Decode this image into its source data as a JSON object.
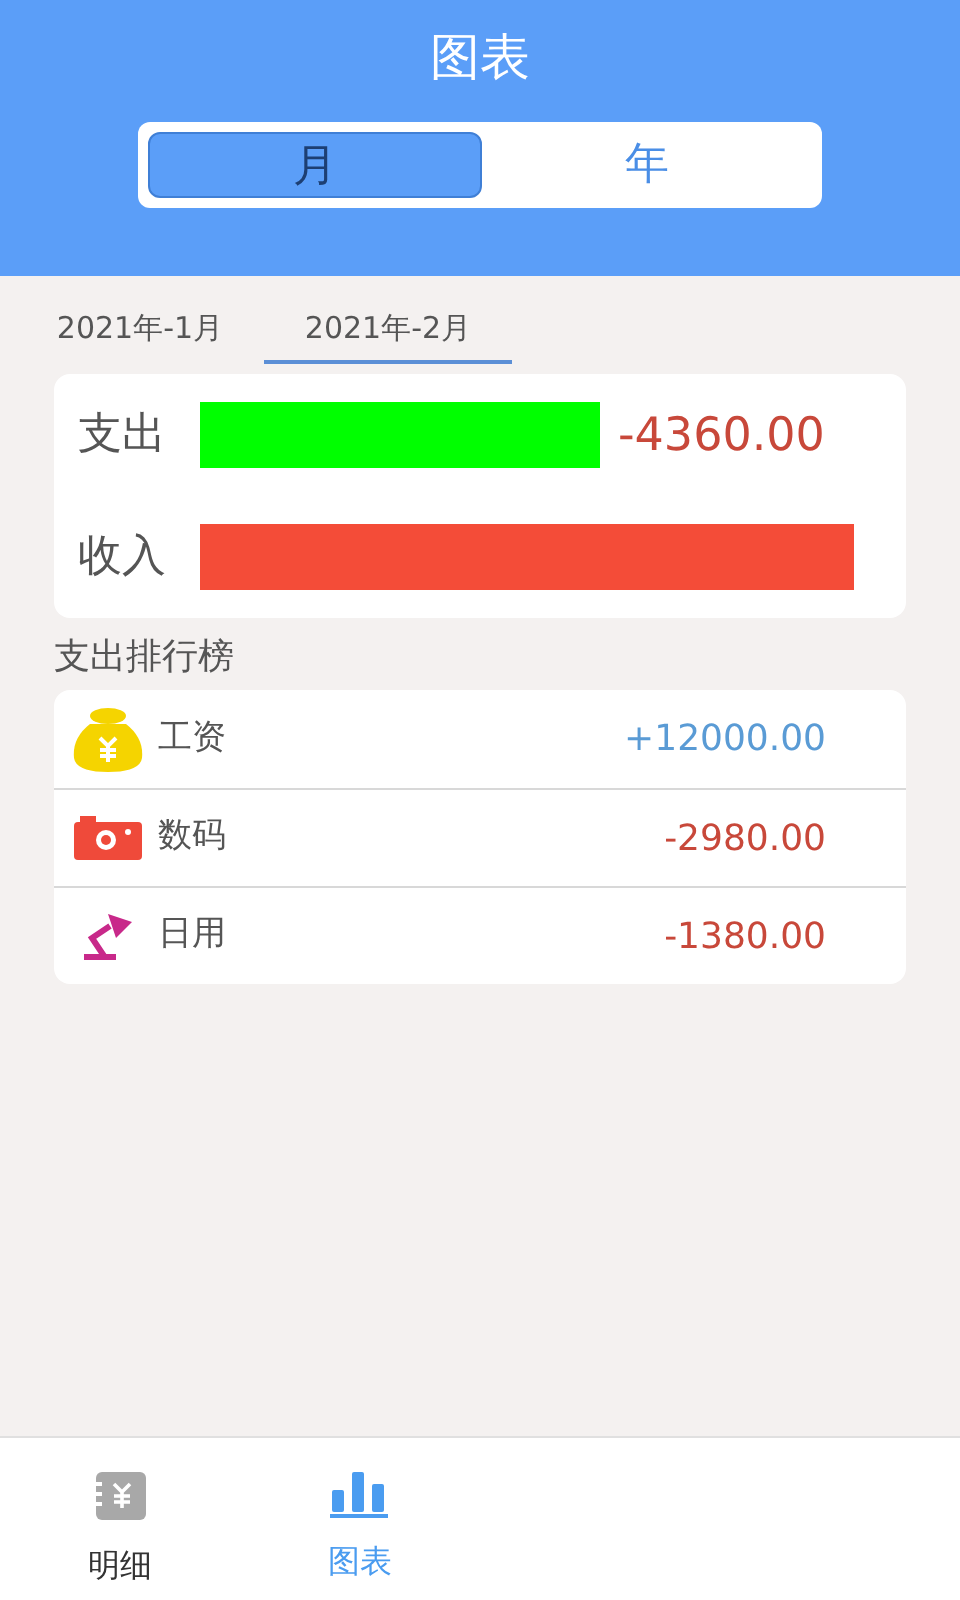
{
  "header": {
    "title": "图表"
  },
  "segments": [
    {
      "label": "月",
      "selected": true
    },
    {
      "label": "年",
      "selected": false
    }
  ],
  "month_tabs": [
    {
      "label": "2021年-1月",
      "selected": false
    },
    {
      "label": "2021年-2月",
      "selected": true
    }
  ],
  "summary": [
    {
      "label": "支出",
      "color": "#00ff00",
      "amount": "-4360.00"
    },
    {
      "label": "收入",
      "color": "#f44c38"
    }
  ],
  "ranking": {
    "title": "支出排行榜",
    "items": [
      {
        "kind": "salary",
        "name": "工资",
        "amount": "+12000.00"
      },
      {
        "kind": "digital",
        "name": "数码",
        "amount": "-2980.00"
      },
      {
        "kind": "daily",
        "name": "日用",
        "amount": "-1380.00"
      }
    ]
  },
  "bottom_nav": [
    {
      "kind": "detail",
      "label": "明细",
      "selected": false
    },
    {
      "kind": "chart",
      "label": "图表",
      "selected": true
    }
  ]
}
